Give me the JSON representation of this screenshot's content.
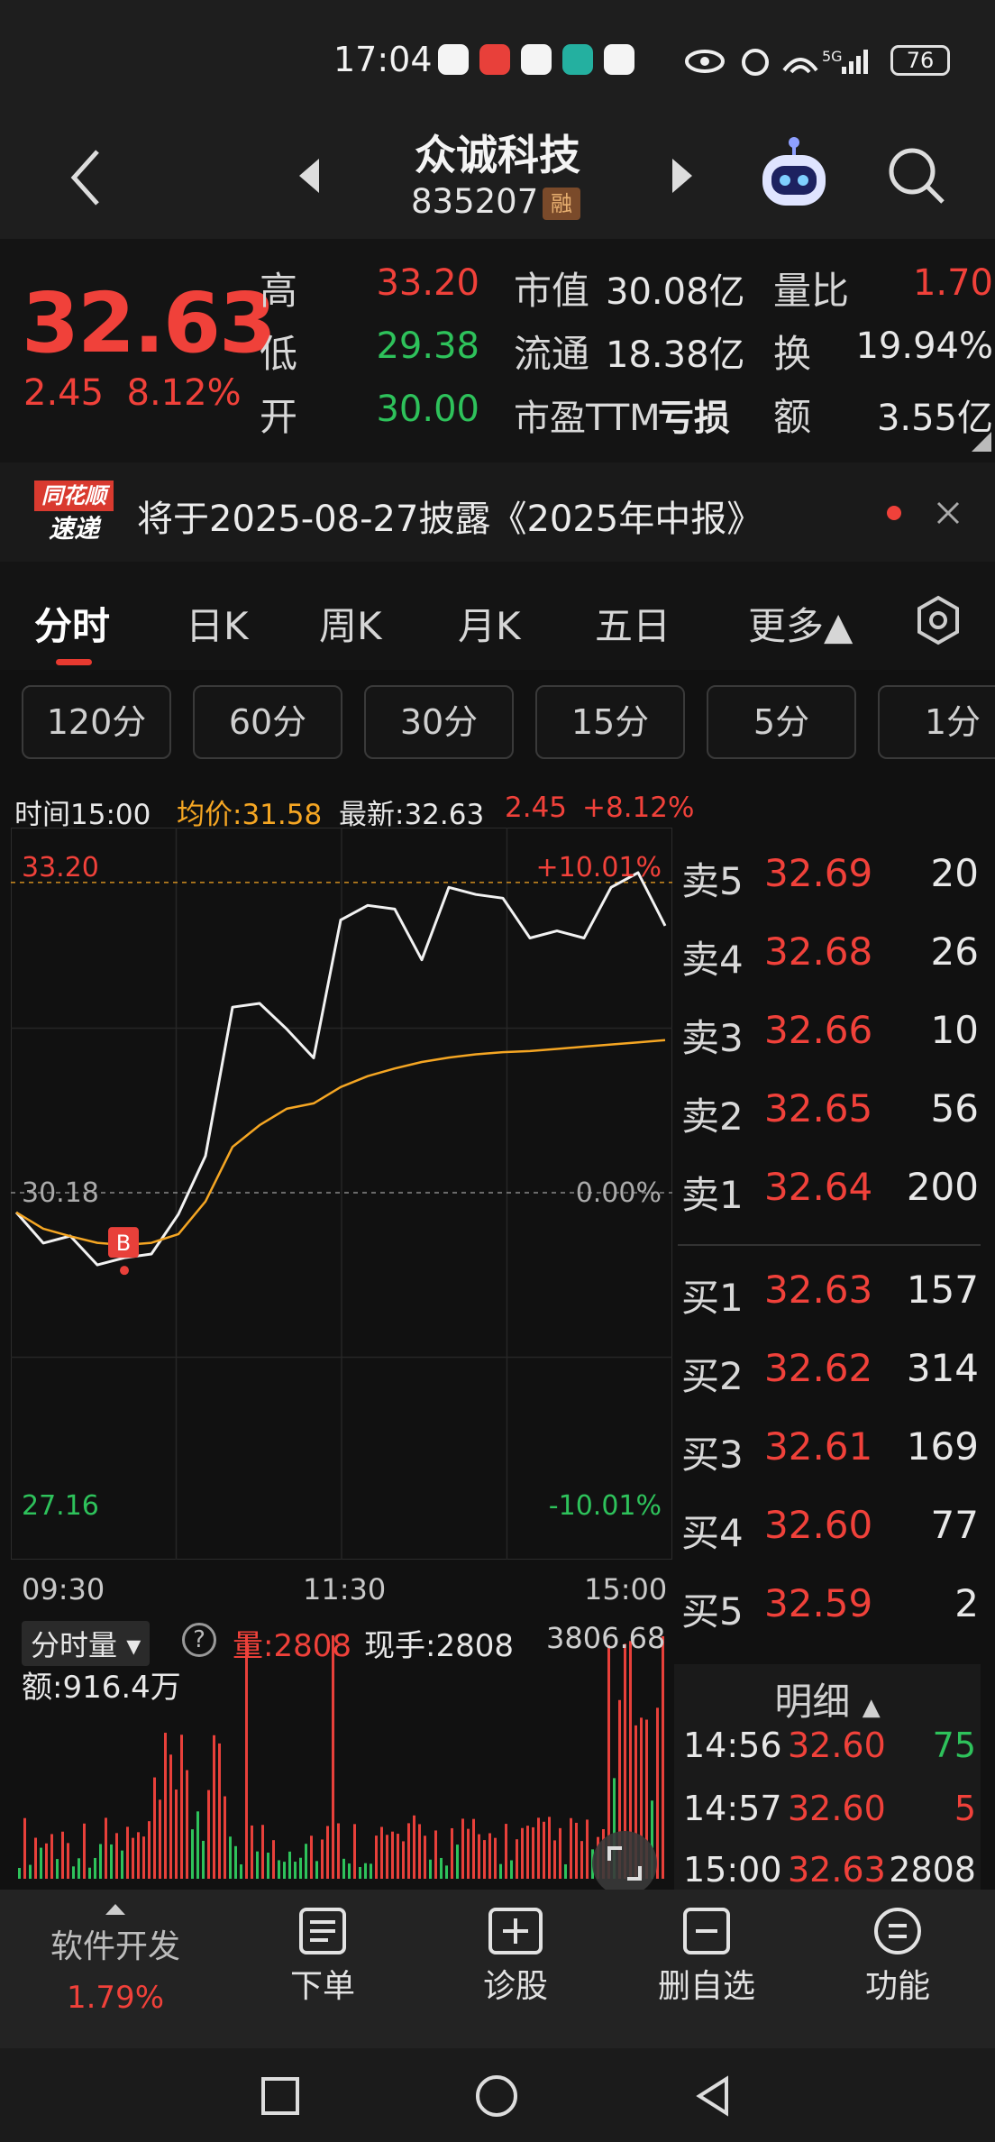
{
  "status_bar": {
    "time": "17:04",
    "battery": "76",
    "network": "5G",
    "icons": [
      "eye-icon",
      "alarm-icon",
      "wifi-icon",
      "signal-icon"
    ]
  },
  "header": {
    "title": "众诚科技",
    "code": "835207",
    "badge": "融"
  },
  "quote": {
    "price": "32.63",
    "change": "2.45",
    "change_pct": "8.12%",
    "high_label": "高",
    "high": "33.20",
    "low_label": "低",
    "low": "29.38",
    "open_label": "开",
    "open": "30.00",
    "mktcap_label": "市值",
    "mktcap": "30.08亿",
    "float_label": "流通",
    "float": "18.38亿",
    "pe_label": "市盈TTM",
    "pe": "亏损",
    "volratio_label": "量比",
    "volratio": "1.70",
    "turnover_label": "换",
    "turnover": "19.94%",
    "amount_label": "额",
    "amount": "3.55亿"
  },
  "news": {
    "badge_top": "同花顺",
    "badge_bottom": "速递",
    "text": "将于2025-08-27披露《2025年中报》"
  },
  "tabs": [
    "分时",
    "日K",
    "周K",
    "月K",
    "五日",
    "更多▲"
  ],
  "periods": [
    "120分",
    "60分",
    "30分",
    "15分",
    "5分",
    "1分"
  ],
  "chart_info": {
    "time": "时间15:00",
    "avg": "均价:31.58",
    "latest": "最新:32.63",
    "change": "2.45",
    "change_pct": "+8.12%"
  },
  "chart_data": {
    "type": "line",
    "ylim": [
      27.16,
      33.2
    ],
    "y_left_labels": [
      "33.20",
      "30.18",
      "27.16"
    ],
    "y_right_labels": [
      "+10.01%",
      "0.00%",
      "-10.01%"
    ],
    "x_labels": [
      "09:30",
      "11:30",
      "15:00"
    ],
    "marker": "B",
    "series": [
      {
        "values": [
          30.0,
          29.8,
          29.7,
          29.6,
          29.5,
          29.7,
          29.9,
          30.6,
          31.8,
          32.0,
          31.6,
          31.5,
          32.6,
          32.9,
          32.7,
          32.4,
          32.9,
          33.0,
          32.8,
          32.6,
          32.5,
          32.6,
          32.9,
          33.2,
          32.63
        ]
      },
      {
        "values": [
          30.0,
          29.85,
          29.78,
          29.72,
          29.7,
          29.72,
          29.8,
          30.1,
          30.6,
          30.8,
          30.95,
          31.0,
          31.15,
          31.25,
          31.32,
          31.38,
          31.42,
          31.45,
          31.47,
          31.48,
          31.5,
          31.52,
          31.54,
          31.56,
          31.58
        ]
      }
    ]
  },
  "orderbook": {
    "asks": [
      {
        "label": "卖5",
        "price": "32.69",
        "vol": "20"
      },
      {
        "label": "卖4",
        "price": "32.68",
        "vol": "26"
      },
      {
        "label": "卖3",
        "price": "32.66",
        "vol": "10"
      },
      {
        "label": "卖2",
        "price": "32.65",
        "vol": "56"
      },
      {
        "label": "卖1",
        "price": "32.64",
        "vol": "200"
      }
    ],
    "bids": [
      {
        "label": "买1",
        "price": "32.63",
        "vol": "157"
      },
      {
        "label": "买2",
        "price": "32.62",
        "vol": "314"
      },
      {
        "label": "买3",
        "price": "32.61",
        "vol": "169"
      },
      {
        "label": "买4",
        "price": "32.60",
        "vol": "77"
      },
      {
        "label": "买5",
        "price": "32.59",
        "vol": "2"
      }
    ]
  },
  "volume": {
    "selector": "分时量",
    "vol": "量:2808",
    "hand": "现手:2808",
    "max": "3806.68",
    "amount": "额:916.4万"
  },
  "detail": {
    "title": "明细",
    "rows": [
      {
        "time": "14:56",
        "price": "32.60",
        "vol": "75"
      },
      {
        "time": "14:57",
        "price": "32.60",
        "vol": "5"
      },
      {
        "time": "15:00",
        "price": "32.63",
        "vol": "2808"
      }
    ]
  },
  "toolbar": {
    "sector": "软件开发",
    "sector_pct": "1.79%",
    "order": "下单",
    "diagnose": "诊股",
    "delete_fav": "删自选",
    "functions": "功能"
  }
}
